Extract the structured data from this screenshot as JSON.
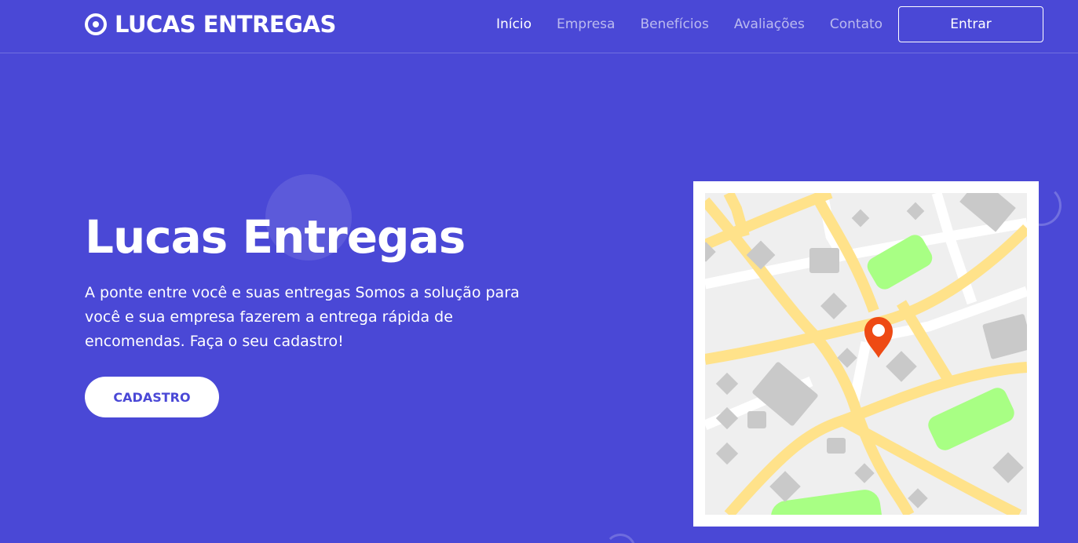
{
  "brand": {
    "name": "LUCAS ENTREGAS",
    "icon": "target-icon"
  },
  "nav": {
    "items": [
      {
        "label": "Início",
        "active": true
      },
      {
        "label": "Empresa",
        "active": false
      },
      {
        "label": "Benefícios",
        "active": false
      },
      {
        "label": "Avaliações",
        "active": false
      },
      {
        "label": "Contato",
        "active": false
      }
    ],
    "login_label": "Entrar"
  },
  "hero": {
    "title": "Lucas Entregas",
    "text": "A ponte entre você e suas entregas Somos a solução para você e sua empresa fazerem a entrega rápida de encomendas. Faça o seu cadastro!",
    "cta_label": "CADASTRO"
  },
  "map_illustration": {
    "icon": "location-pin-icon"
  },
  "colors": {
    "background": "#4a48d6",
    "text": "#ffffff",
    "map_road": "#ffe28a",
    "map_park": "#a8ff84",
    "map_building": "#c9c9c9",
    "map_ground": "#efefef",
    "pin": "#ee4a14"
  }
}
